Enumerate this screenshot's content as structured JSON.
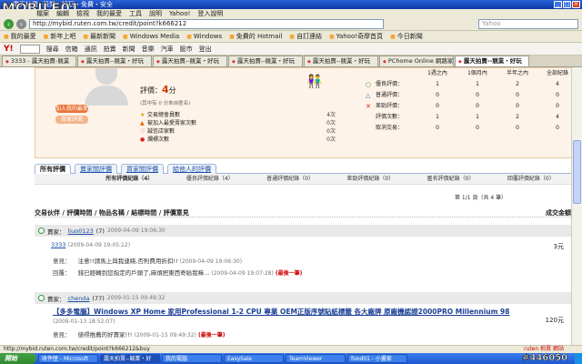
{
  "window": {
    "title": "露天拍賣--競業・好玩・免費・安全",
    "watermark": "MOBILE01"
  },
  "menubar": {
    "items": [
      "檔案",
      "編輯",
      "檢視",
      "我的最愛",
      "工具",
      "說明",
      "Yahoo!",
      "登入說明"
    ]
  },
  "address": {
    "url": "http://mybid.ruten.com.tw/credit/point?k666212",
    "search_placeholder": "Yahoo"
  },
  "favorites": {
    "items": [
      "我的最愛",
      "新年上吧",
      "最新新聞",
      "Windows Media",
      "Windows",
      "免費的 Hotmail",
      "自訂連結",
      "Yahoo!奇摩首頁",
      "今日新聞"
    ]
  },
  "ytoolbar": {
    "logo": "Y!",
    "items": [
      "搜尋",
      "信箱",
      "通訊",
      "拍賣",
      "新聞",
      "音樂",
      "汽車",
      "股市",
      "登出"
    ]
  },
  "tabs": [
    {
      "label": "3333 - 露天拍賣-競業"
    },
    {
      "label": "露天拍賣--競業・好玩"
    },
    {
      "label": "露天拍賣--競業・好玩"
    },
    {
      "label": "露天拍賣--競業・好玩"
    },
    {
      "label": "露天拍賣--競業・好玩"
    },
    {
      "label": "PChome Online 網路家庭"
    },
    {
      "label": "露天拍賣--競業・好玩"
    }
  ],
  "profile": {
    "btn1": "加入我的最愛",
    "btn2": "買家評價",
    "score_label": "評價：",
    "score": "4",
    "score_unit": "分",
    "score_sub": "(其中有 0 分來自匿名)",
    "stats": [
      {
        "icon": "★",
        "label": "交易總會員數",
        "value": "4次"
      },
      {
        "icon": "▲",
        "label": "被加入最愛賣家次數",
        "value": "0次"
      },
      {
        "icon": "♡",
        "label": "誠信店家數",
        "value": "0次"
      },
      {
        "icon": "●",
        "label": "爛標次數",
        "value": "0次"
      }
    ]
  },
  "rating_table": {
    "headers": [
      "1週之內",
      "1個月內",
      "半年之內",
      "全部紀錄"
    ],
    "rows": [
      {
        "sym": "○",
        "label": "優良評價：",
        "values": [
          "1",
          "1",
          "2",
          "4"
        ]
      },
      {
        "sym": "△",
        "label": "普通評價：",
        "values": [
          "0",
          "0",
          "0",
          "0"
        ]
      },
      {
        "sym": "✕",
        "label": "差勁評價：",
        "values": [
          "0",
          "0",
          "0",
          "0"
        ]
      },
      {
        "sym": "",
        "label": "評價次數：",
        "values": [
          "1",
          "1",
          "2",
          "4"
        ]
      },
      {
        "sym": "",
        "label": "取消交易：",
        "values": [
          "0",
          "0",
          "0",
          "0"
        ]
      }
    ]
  },
  "subnav": {
    "tabs": [
      "所有評價",
      "賣家間評價",
      "買家間評價",
      "給他人的評價"
    ]
  },
  "filters": [
    "所有評價紀錄（4）",
    "優良評價紀錄（4）",
    "普通評價紀錄（0）",
    "差勁評價紀錄（0）",
    "匿名評價紀錄（0）",
    "回覆評價紀錄（0）"
  ],
  "pageinfo": "第 1/1 頁（共 4 筆）",
  "columns": {
    "left": "交易伙伴 / 評價時間 / 物品名稱 / 結標時間 / 評價意見",
    "right": "成交金額"
  },
  "entries": [
    {
      "role": "賣家：",
      "user": "liuo0123",
      "count": "(7)",
      "date": "2009-04-09 19:06:30",
      "item": "3333",
      "item_date": "(2009-04-09 19:05:12)",
      "price": "3元",
      "comment_label": "意見：",
      "comment": "注意!!請馬上與我連絡,否則費用折扣!!",
      "comment_date": "(2009-04-09 19:06:30)",
      "reply_label": "回覆：",
      "reply": "錢已經轉到您指定的戶頭了,麻煩把東西寄給我嘛...",
      "reply_date": "(2009-04-09 19:07:28)",
      "more": "(最後一筆)"
    },
    {
      "role": "賣家：",
      "user": "chenda",
      "count": "(77)",
      "date": "2009-01-15 09:49:32",
      "item": "【多多電腦】Windows XP Home 家用Professional 1-2 CPU 專業 OEM正版序號貼紙標籤 各大廠牌 原廠機認證2000PRO Millennium 98",
      "item_date": "(2009-01-13 18:52:07)",
      "price": "120元",
      "comment_label": "意見：",
      "comment": "値得推薦的好賣家!!!",
      "comment_date": "(2009-01-15 09:49:32)",
      "more": "(最後一筆)"
    }
  ],
  "status": {
    "url": "http://mybid.ruten.com.tw/credit/point?k666212&buy",
    "right": "ruten 拍賣 網站"
  },
  "taskbar": {
    "start": "開始",
    "buttons": [
      "收件匣 - Microsoft",
      "露天拍賣--競業・好",
      "我的電腦",
      "EasySale",
      "TeamViewer",
      "food01 - 小畫家"
    ],
    "tray": "#446050"
  }
}
